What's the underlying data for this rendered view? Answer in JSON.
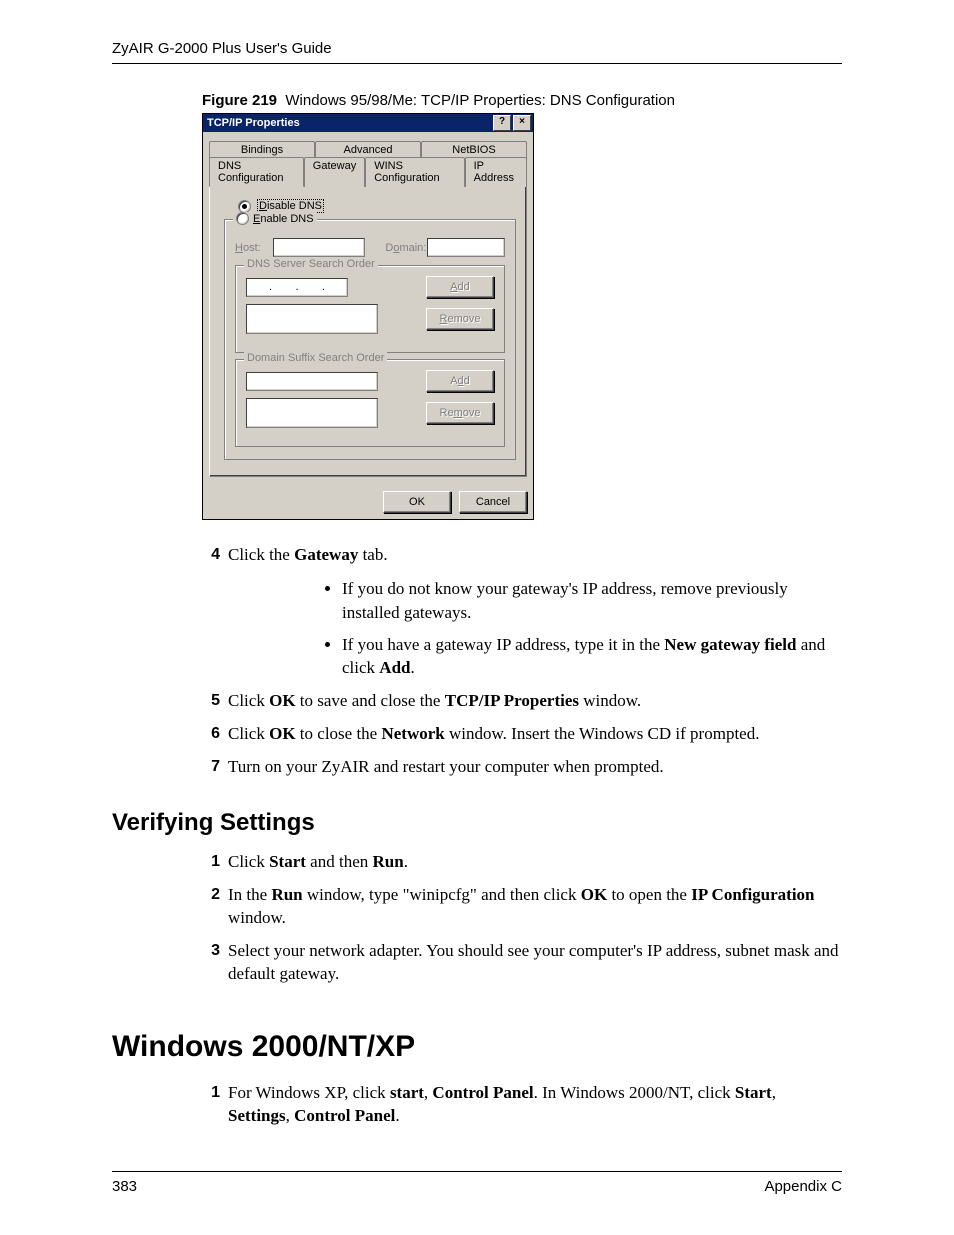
{
  "header": {
    "guide": "ZyAIR G-2000 Plus User's Guide"
  },
  "figure": {
    "num": "Figure 219",
    "caption": "Windows 95/98/Me: TCP/IP Properties: DNS Configuration"
  },
  "dialog": {
    "title": "TCP/IP Properties",
    "help_glyph": "?",
    "close_glyph": "×",
    "tabs_row1": [
      "Bindings",
      "Advanced",
      "NetBIOS"
    ],
    "tabs_row2": [
      "DNS Configuration",
      "Gateway",
      "WINS Configuration",
      "IP Address"
    ],
    "active_tab": "DNS Configuration",
    "radio_disable": "Disable DNS",
    "radio_enable": "Enable DNS",
    "host_label": "Host:",
    "domain_label": "Domain:",
    "group1": "DNS Server Search Order",
    "group2": "Domain Suffix Search Order",
    "btn_add": "Add",
    "btn_remove": "Remove",
    "btn_ok": "OK",
    "btn_cancel": "Cancel"
  },
  "steps_a": {
    "s4_num": "4",
    "s4_a": "Click the ",
    "s4_b": "Gateway",
    "s4_c": " tab.",
    "b1": "If you do not know your gateway's IP address, remove previously installed gateways.",
    "b2_a": "If you have a gateway IP address, type it in the ",
    "b2_b": "New gateway field",
    "b2_c": " and click ",
    "b2_d": "Add",
    "b2_e": ".",
    "s5_num": "5",
    "s5_a": "Click ",
    "s5_b": "OK",
    "s5_c": " to save and close the ",
    "s5_d": "TCP/IP Properties",
    "s5_e": " window.",
    "s6_num": "6",
    "s6_a": "Click ",
    "s6_b": "OK",
    "s6_c": " to close the ",
    "s6_d": "Network",
    "s6_e": " window. Insert the Windows CD if prompted.",
    "s7_num": "7",
    "s7": "Turn on your ZyAIR and restart your computer when prompted."
  },
  "section1": {
    "title": "Verifying Settings"
  },
  "steps_b": {
    "s1_num": "1",
    "s1_a": "Click ",
    "s1_b": "Start",
    "s1_c": " and then ",
    "s1_d": "Run",
    "s1_e": ".",
    "s2_num": "2",
    "s2_a": "In the ",
    "s2_b": "Run",
    "s2_c": " window, type \"winipcfg\" and then click ",
    "s2_d": "OK",
    "s2_e": " to open the ",
    "s2_f": "IP Configuration",
    "s2_g": " window.",
    "s3_num": "3",
    "s3": "Select your network adapter. You should see your computer's IP address, subnet mask and default gateway."
  },
  "section2": {
    "title": "Windows 2000/NT/XP"
  },
  "steps_c": {
    "s1_num": "1",
    "s1_a": "For Windows XP, click ",
    "s1_b": "start",
    "s1_c": ", ",
    "s1_d": "Control Panel",
    "s1_e": ". In Windows 2000/NT, click ",
    "s1_f": "Start",
    "s1_g": ", ",
    "s1_h": "Settings",
    "s1_i": ", ",
    "s1_j": "Control Panel",
    "s1_k": "."
  },
  "footer": {
    "page": "383",
    "appendix": "Appendix C"
  }
}
